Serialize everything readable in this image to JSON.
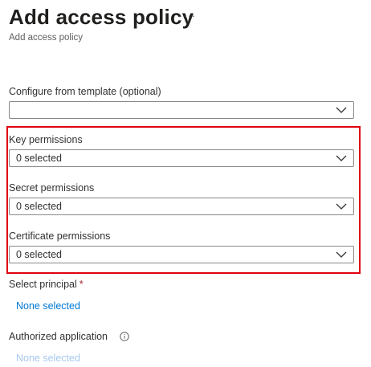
{
  "header": {
    "title": "Add access policy",
    "subtitle": "Add access policy",
    "more_glyph": "···"
  },
  "form": {
    "template": {
      "label": "Configure from template (optional)",
      "value": ""
    },
    "key_permissions": {
      "label": "Key permissions",
      "value": "0 selected"
    },
    "secret_permissions": {
      "label": "Secret permissions",
      "value": "0 selected"
    },
    "certificate_permissions": {
      "label": "Certificate permissions",
      "value": "0 selected"
    },
    "principal": {
      "label": "Select principal",
      "required_mark": "*",
      "link": "None selected"
    },
    "authorized_application": {
      "label": "Authorized application",
      "link": "None selected",
      "icon": "info-icon"
    }
  },
  "colors": {
    "highlight": "#e0000d",
    "link": "#0078d4",
    "link_disabled": "#a6c8ee",
    "required": "#a4262c"
  },
  "icons": {
    "dropdown": "chevron-down-icon",
    "more": "more-icon"
  }
}
